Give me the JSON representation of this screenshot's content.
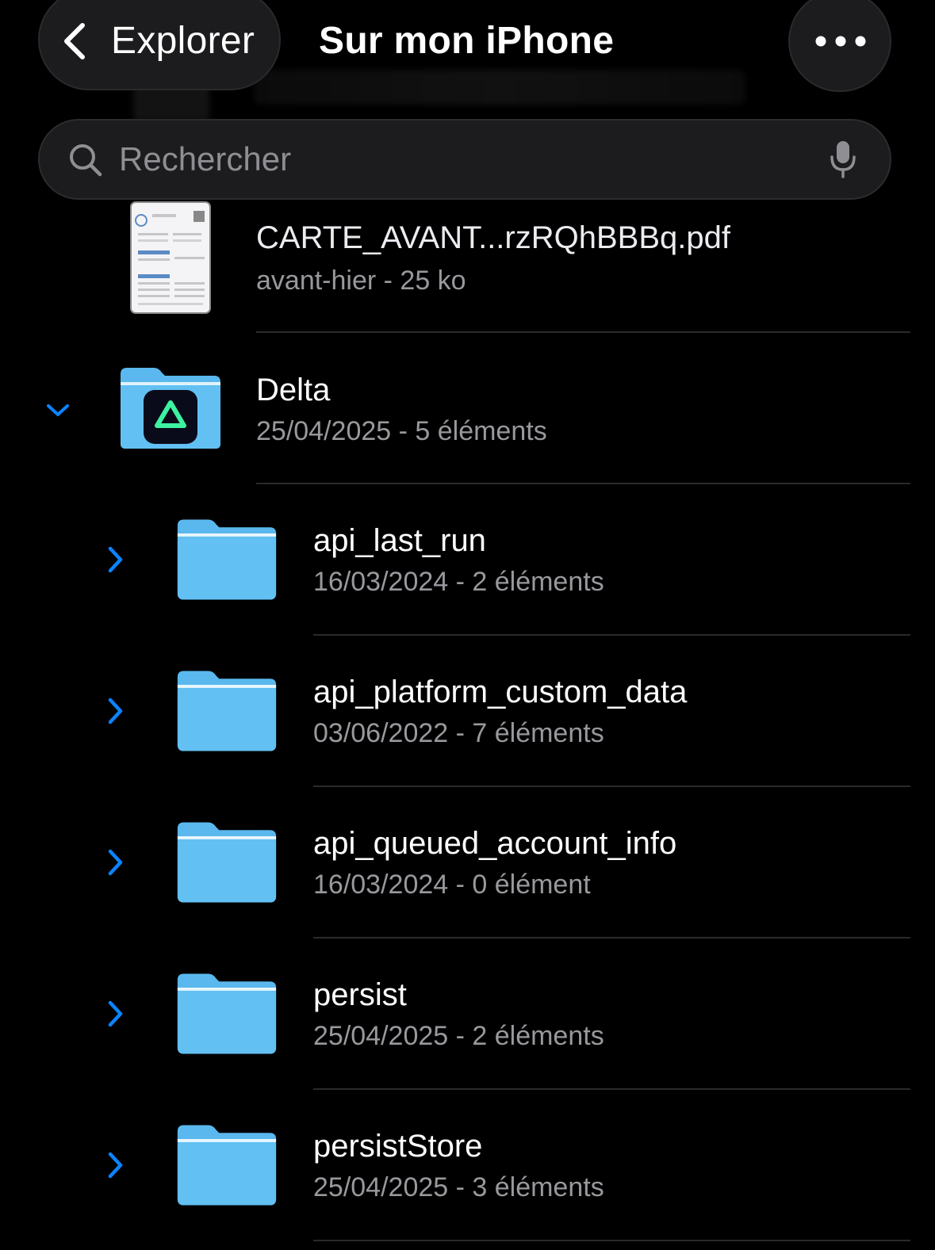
{
  "header": {
    "back_label": "Explorer",
    "title": "Sur mon iPhone"
  },
  "search": {
    "placeholder": "Rechercher"
  },
  "file": {
    "name": "CARTE_AVANT...rzRQhBBBq.pdf",
    "meta": "avant-hier - 25 ko"
  },
  "delta": {
    "name": "Delta",
    "meta": "25/04/2025 - 5 éléments"
  },
  "folders": [
    {
      "name": "api_last_run",
      "meta": "16/03/2024 - 2 éléments"
    },
    {
      "name": "api_platform_custom_data",
      "meta": "03/06/2022 - 7 éléments"
    },
    {
      "name": "api_queued_account_info",
      "meta": "16/03/2024 - 0 élément"
    },
    {
      "name": "persist",
      "meta": "25/04/2025 - 2 éléments"
    },
    {
      "name": "persistStore",
      "meta": "25/04/2025 - 3 éléments"
    }
  ],
  "colors": {
    "accent": "#0a84ff",
    "folder": "#5ab8ee",
    "background": "#000000"
  }
}
